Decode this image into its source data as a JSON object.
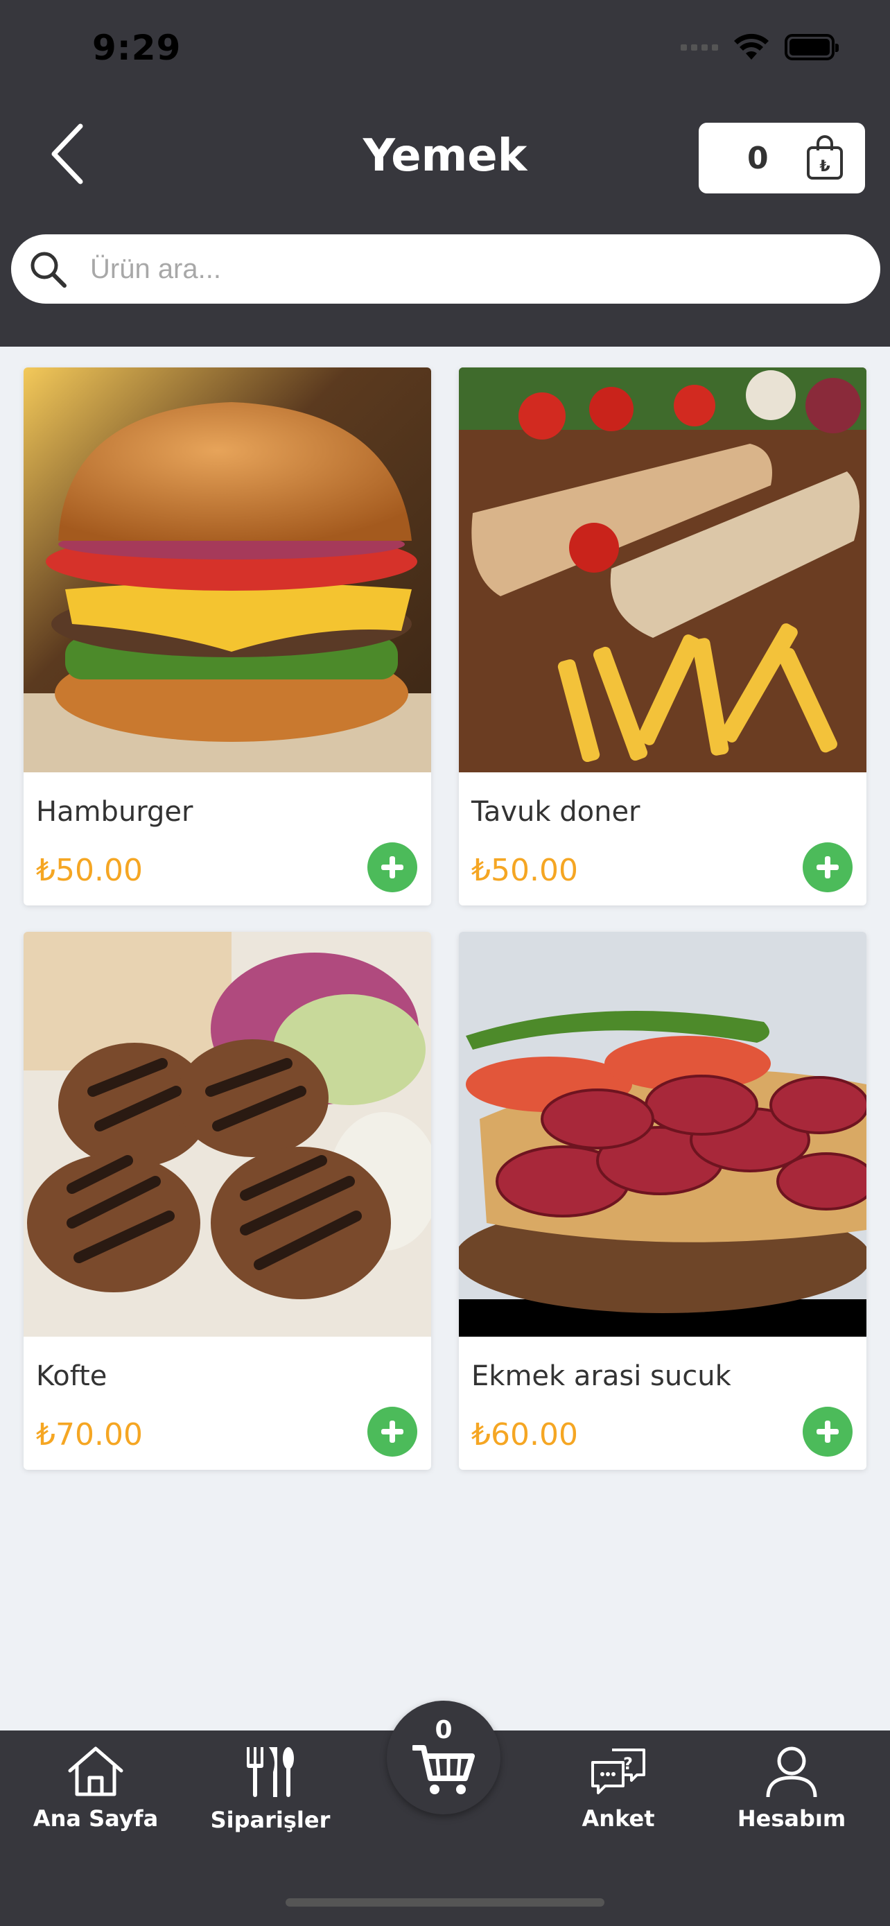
{
  "status_bar": {
    "time": "9:29"
  },
  "header": {
    "title": "Yemek",
    "cart_count": "0"
  },
  "search": {
    "placeholder": "Ürün ara..."
  },
  "products": [
    {
      "name": "Hamburger",
      "price": "₺50.00",
      "image": "hamburger"
    },
    {
      "name": "Tavuk doner",
      "price": "₺50.00",
      "image": "tavuk-doner"
    },
    {
      "name": "Kofte",
      "price": "₺70.00",
      "image": "kofte"
    },
    {
      "name": "Ekmek arasi sucuk",
      "price": "₺60.00",
      "image": "sucuk-sandwich"
    }
  ],
  "bottom_nav": {
    "items": [
      {
        "label": "Ana Sayfa",
        "icon": "home-icon"
      },
      {
        "label": "Siparişler",
        "icon": "cutlery-icon"
      },
      {
        "label": "Anket",
        "icon": "survey-chat-icon"
      },
      {
        "label": "Hesabım",
        "icon": "user-icon"
      }
    ],
    "cart_count": "0",
    "cart_icon": "cart-icon"
  },
  "colors": {
    "header_bg": "#37373d",
    "page_bg": "#eef1f5",
    "price": "#f5a623",
    "add_button": "#4cbb5a"
  }
}
